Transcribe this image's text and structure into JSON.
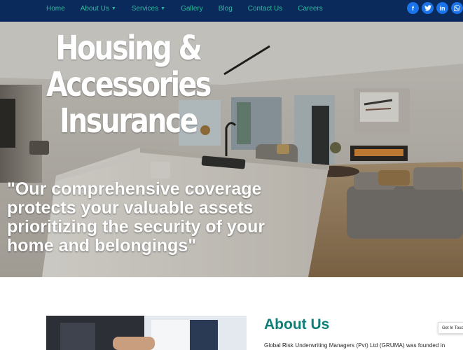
{
  "nav": {
    "items": [
      {
        "label": "Home",
        "dropdown": false
      },
      {
        "label": "About Us",
        "dropdown": true
      },
      {
        "label": "Services",
        "dropdown": true
      },
      {
        "label": "Gallery",
        "dropdown": false
      },
      {
        "label": "Blog",
        "dropdown": false
      },
      {
        "label": "Contact Us",
        "dropdown": false
      },
      {
        "label": "Careers",
        "dropdown": false
      }
    ],
    "socials": [
      {
        "icon": "facebook-icon",
        "glyph": "f"
      },
      {
        "icon": "twitter-icon",
        "glyph": "t"
      },
      {
        "icon": "linkedin-icon",
        "glyph": "in"
      },
      {
        "icon": "whatsapp-icon",
        "glyph": "w"
      }
    ],
    "colors": {
      "bar": "#0a2a5b",
      "link": "#2fb89a",
      "social": "#1a73e8"
    }
  },
  "hero": {
    "title_line1": "Housing &",
    "title_line2": "Accessories",
    "title_line3": "Insurance",
    "quote": "\"Our comprehensive coverage protects your valuable assets prioritizing the security of your home and belongings\""
  },
  "about": {
    "title": "About Us",
    "text": "Global Risk Underwriting Managers (Pvt) Ltd (GRUMA) was founded in",
    "title_color": "#0f7d78"
  },
  "widget": {
    "label": "Get In Touch"
  }
}
